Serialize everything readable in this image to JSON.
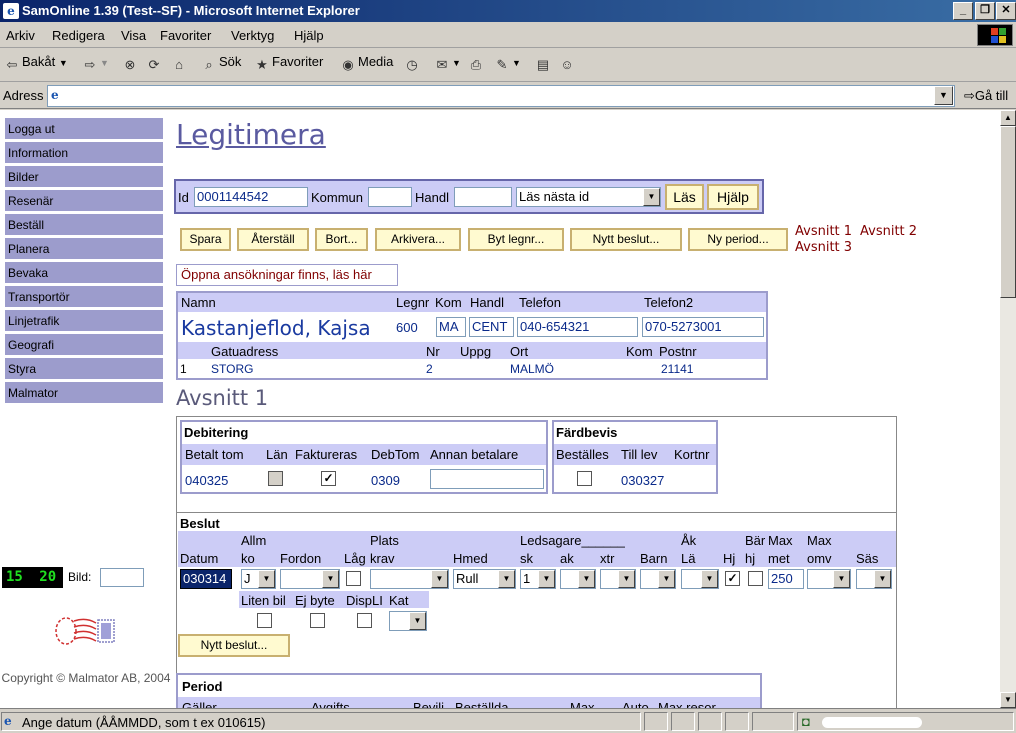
{
  "window": {
    "title": "SamOnline 1.39 (Test--SF) - Microsoft Internet Explorer"
  },
  "menu": [
    "Arkiv",
    "Redigera",
    "Visa",
    "Favoriter",
    "Verktyg",
    "Hjälp"
  ],
  "toolbar": {
    "back": "Bakåt",
    "search": "Sök",
    "favorites": "Favoriter",
    "media": "Media"
  },
  "address": {
    "label": "Adress",
    "value": "",
    "go": "Gå till"
  },
  "sidebar": {
    "items": [
      "Logga ut",
      "Information",
      "Bilder",
      "Resenär",
      "Beställ",
      "Planera",
      "Bevaka",
      "Transportör",
      "Linjetrafik",
      "Geografi",
      "Styra",
      "Malmator"
    ],
    "counter_a": "15",
    "counter_b": "20",
    "bild_label": "Bild:",
    "bild_value": "",
    "copyright": "Copyright © Malmator AB, 2004"
  },
  "page": {
    "title": "Legitimera",
    "search": {
      "id_label": "Id",
      "id_value": "0001144542",
      "kommun_label": "Kommun",
      "kommun_value": "",
      "handl_label": "Handl",
      "handl_value": "",
      "select_value": "Läs nästa id",
      "las_button": "Läs",
      "hjalp_button": "Hjälp"
    },
    "actions": [
      "Spara",
      "Återställ",
      "Bort...",
      "Arkivera...",
      "Byt legnr...",
      "Nytt beslut...",
      "Ny period..."
    ],
    "links": {
      "avsnitt1": "Avsnitt 1",
      "avsnitt2": "Avsnitt 2",
      "avsnitt3": "Avsnitt 3"
    },
    "open_applications": "Öppna ansökningar finns, läs här",
    "person": {
      "headers": {
        "namn": "Namn",
        "legnr": "Legnr",
        "kom": "Kom",
        "handl": "Handl",
        "telefon": "Telefon",
        "telefon2": "Telefon2"
      },
      "name": "Kastanjeflod, Kajsa",
      "legnr": "600",
      "kom": "MA",
      "handl": "CENT",
      "telefon": "040-654321",
      "telefon2": "070-5273001",
      "addr_headers": {
        "gatuadress": "Gatuadress",
        "nr": "Nr",
        "uppg": "Uppg",
        "ort": "Ort",
        "kom": "Kom",
        "postnr": "Postnr"
      },
      "addr": {
        "row": "1",
        "gatuadress": "STORG",
        "nr": "2",
        "uppg": "",
        "ort": "MALMÖ",
        "kom": "",
        "postnr": "21141"
      }
    },
    "section_title": "Avsnitt 1",
    "debitering": {
      "title": "Debitering",
      "headers": {
        "betalt_tom": "Betalt tom",
        "lan": "Län",
        "faktureras": "Faktureras",
        "debtom": "DebTom",
        "annan": "Annan betalare"
      },
      "betalt_tom": "040325",
      "lan_checked": false,
      "faktureras_checked": true,
      "debtom": "0309",
      "annan": ""
    },
    "fardbevis": {
      "title": "Färdbevis",
      "headers": {
        "bestalles": "Beställes",
        "till_lev": "Till lev",
        "kortnr": "Kortnr"
      },
      "bestalles_checked": false,
      "till_lev": "030327",
      "kortnr": ""
    },
    "beslut": {
      "title": "Beslut",
      "headers_top": {
        "allm": "Allm",
        "plats": "Plats",
        "ledsagare": "Ledsagare______",
        "ak": "Åk",
        "bar": "Bär",
        "max": "Max",
        "max2": "Max"
      },
      "headers_bottom": {
        "datum": "Datum",
        "ko": "ko",
        "fordon": "Fordon",
        "lag": "Låg",
        "krav": "krav",
        "hmed": "Hmed",
        "sk": "sk",
        "ak": "ak",
        "xtr": "xtr",
        "barn": "Barn",
        "la": "Lä",
        "hj": "Hj",
        "hj2": "hj",
        "met": "met",
        "omv": "omv",
        "sas": "Säs"
      },
      "datum": "030314",
      "allm_ko": "J",
      "fordon": "",
      "lag_checked": false,
      "platskrav": "",
      "hmed": "Rull",
      "sk": "1",
      "ak": "",
      "xtr": "",
      "barn": "",
      "la": "",
      "hj_checked": true,
      "barhj_checked": false,
      "maxmet": "250",
      "maxomv": "",
      "sas": "",
      "sub_headers": {
        "liten_bil": "Liten bil",
        "ej_byte": "Ej byte",
        "displi": "DispLI",
        "kat": "Kat"
      },
      "liten_bil_checked": false,
      "ej_byte_checked": false,
      "displi_checked": false,
      "kat": "",
      "new_button": "Nytt beslut..."
    },
    "period": {
      "title": "Period",
      "headers": [
        "Gäller",
        "Avgifts",
        "Bevilj",
        "Beställda",
        "Max",
        "Auto",
        "Max resor"
      ]
    }
  },
  "status": {
    "text": "Ange datum (ÅÅMMDD, som t ex 010615)"
  }
}
